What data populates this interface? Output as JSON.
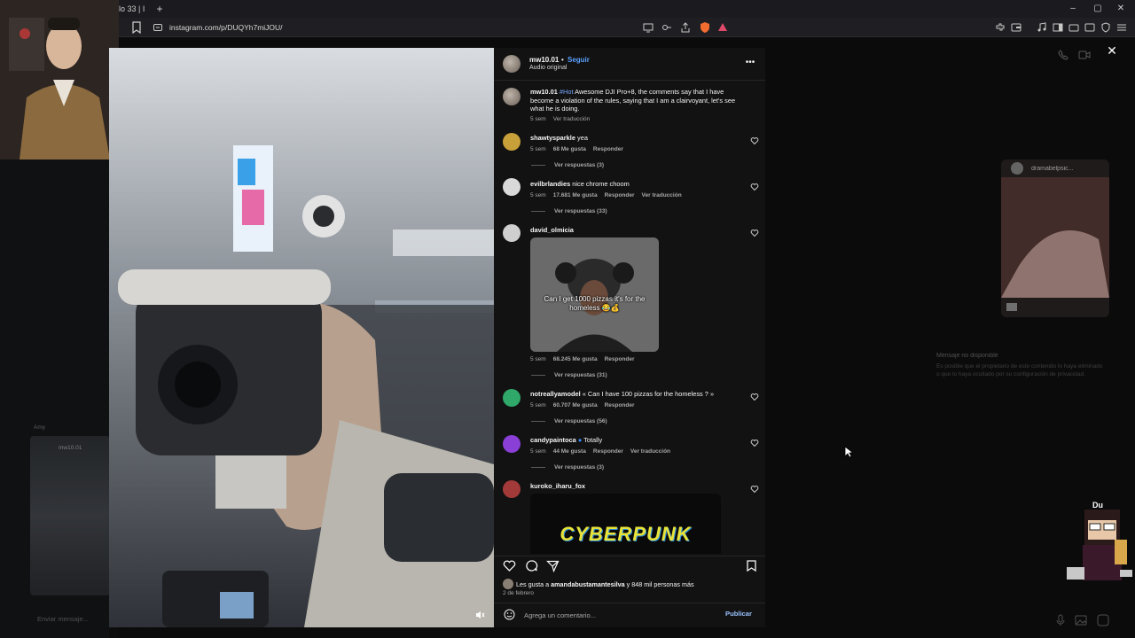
{
  "browser": {
    "tab_title": "lo 33 | I",
    "url": "instagram.com/p/DUQYh7miJOU/",
    "new_tab": "+",
    "window_controls": [
      "–",
      "▢",
      "✕"
    ]
  },
  "post": {
    "username": "mw10.01",
    "dot": "•",
    "follow_label": "Seguir",
    "audio": "Audio original",
    "caption": {
      "username": "mw10.01",
      "hashtag": "#Hot",
      "text": "Awesome DJI Pro+8, the comments say that I have become a violation of the rules, saying that I am a clairvoyant, let's see what he is doing.",
      "time": "5 sem",
      "translate": "Ver traducción"
    },
    "likes_text_prefix": "Les gusta a ",
    "likes_user": "amandabustamantesilva",
    "likes_text_suffix": " y 848 mil personas más",
    "date": "2 de febrero",
    "comment_placeholder": "Agrega un comentario...",
    "publish_label": "Publicar"
  },
  "comments": [
    {
      "user": "shawtysparkle",
      "text": "yea",
      "time": "5 sem",
      "likes": "68 Me gusta",
      "reply": "Responder",
      "translate": "",
      "replies": "Ver respuestas (3)",
      "avatar_color": "#c8a03a"
    },
    {
      "user": "evilbrlandies",
      "text": "nice chrome choom",
      "time": "5 sem",
      "likes": "17.681 Me gusta",
      "reply": "Responder",
      "translate": "Ver traducción",
      "replies": "Ver respuestas (33)",
      "avatar_color": "#d9d9d9"
    },
    {
      "user": "david_olmicia",
      "text": "",
      "time": "5 sem",
      "likes": "68.245 Me gusta",
      "reply": "Responder",
      "translate": "",
      "replies": "Ver respuestas (31)",
      "avatar_color": "#cfcfcf",
      "gif_caption": "Can I get 1000 pizzas it's for the homeless 😂💰"
    },
    {
      "user": "notreallyamodel",
      "text": "« Can I have 100 pizzas for the homeless ? »",
      "time": "5 sem",
      "likes": "60.707 Me gusta",
      "reply": "Responder",
      "translate": "",
      "replies": "Ver respuestas (56)",
      "avatar_color": "#2fa86a"
    },
    {
      "user": "candypaintoca",
      "text": "Totally",
      "time": "5 sem",
      "likes": "44 Me gusta",
      "reply": "Responder",
      "translate": "Ver traducción",
      "replies": "Ver respuestas (3)",
      "avatar_color": "#8a3fd6"
    },
    {
      "user": "kuroko_iharu_fox",
      "text": "",
      "avatar_color": "#a33a3a",
      "gif_caption": "CYBERPUNK"
    }
  ],
  "background": {
    "dm_card_name": "dramabelpsic...",
    "unavailable_title": "Mensaje no disponible",
    "unavailable_body": "Es posible que el propietario de este contenido lo haya eliminado o que lo haya ocultado por su configuración de privacidad.",
    "left_chat_name": "Amy",
    "left_thumb_name": "mw10.01",
    "message_placeholder": "Enviar mensaje...",
    "sprite_name": "Du"
  }
}
